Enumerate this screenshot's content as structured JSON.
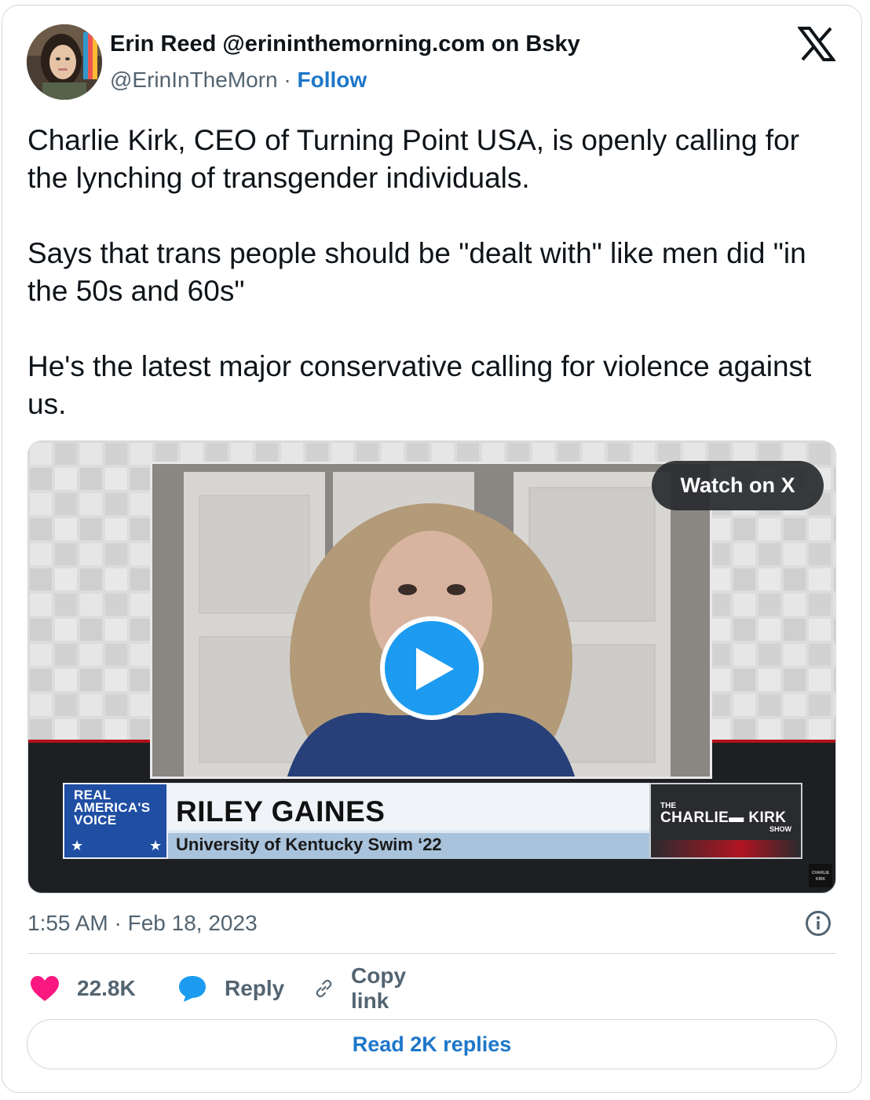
{
  "colors": {
    "accent": "#1d77c9",
    "text_primary": "#0f1419",
    "text_secondary": "#536471",
    "like": "#f91880",
    "reply_icon": "#1d9bf0",
    "border": "#cfd9de"
  },
  "author": {
    "display_name": "Erin Reed @erininthemorning.com on Bsky",
    "handle": "@ErinInTheMorn",
    "separator": "·",
    "follow_label": "Follow"
  },
  "platform_icon": "x-logo-icon",
  "tweet": {
    "paragraphs": [
      "Charlie Kirk, CEO of Turning Point USA, is openly calling for the lynching of transgender individuals.",
      "Says that trans people should be \"dealt with\" like men did \"in the 50s and 60s\"",
      "He's the latest major conservative calling for violence against us."
    ]
  },
  "media": {
    "watch_label": "Watch on X",
    "play_icon": "play-icon",
    "lower_third": {
      "network_line1": "REAL",
      "network_line2": "AMERICA'S",
      "network_line3": "VOICE",
      "name": "RILEY GAINES",
      "subtitle": "University of Kentucky Swim ‘22",
      "show_the": "THE",
      "show_name": "CHARLIE▬ KIRK",
      "show_word": "SHOW"
    },
    "corner_bug": "CHARLIE KIRK"
  },
  "meta": {
    "time": "1:55 AM",
    "separator": "·",
    "date": "Feb 18, 2023",
    "info_icon": "info-icon"
  },
  "actions": {
    "like_count": "22.8K",
    "reply_label": "Reply",
    "copy_label": "Copy link"
  },
  "read_replies_label": "Read 2K replies"
}
